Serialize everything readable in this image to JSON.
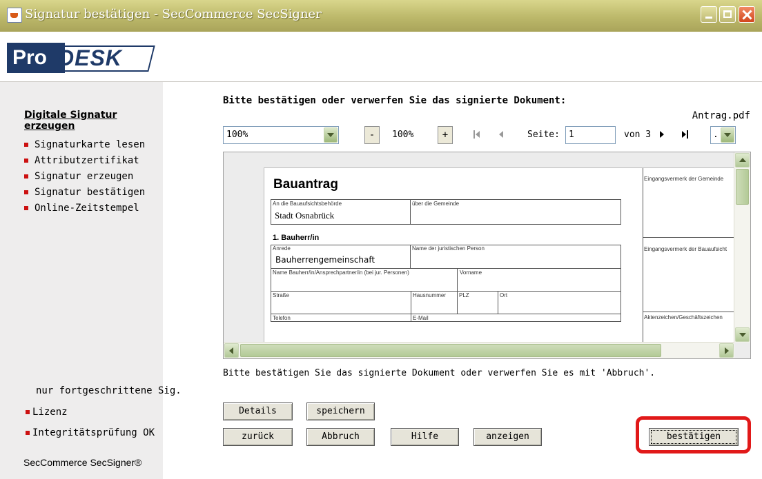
{
  "window": {
    "title": "Signatur bestätigen - SecCommerce SecSigner",
    "icon": "java-cup-icon"
  },
  "logo": {
    "part1": "Pro",
    "part2": "DESK"
  },
  "sidebar": {
    "heading": "Digitale Signatur erzeugen",
    "items": [
      {
        "label": "Signaturkarte lesen"
      },
      {
        "label": "Attributzertifikat"
      },
      {
        "label": "Signatur erzeugen"
      },
      {
        "label": "Signatur bestätigen"
      },
      {
        "label": "Online-Zeitstempel"
      }
    ],
    "note": "nur fortgeschrittene Sig.",
    "license": "Lizenz",
    "integrity": "Integritätsprüfung OK",
    "brand": "SecCommerce SecSigner®",
    "bullet_color": "#cc1111"
  },
  "main": {
    "prompt": "Bitte bestätigen oder verwerfen Sie das signierte Dokument:",
    "filename": "Antrag.pdf",
    "instruction": "Bitte bestätigen Sie das signierte Dokument oder verwerfen Sie es mit 'Abbruch'."
  },
  "toolbar": {
    "zoom_select": "100%",
    "zoom_out": "-",
    "zoom_value": "100%",
    "zoom_in": "+",
    "page_label": "Seite:",
    "page_value": "1",
    "of_label": "von 3",
    "mode_select": "."
  },
  "document": {
    "title": "Bauantrag",
    "field_authority": "An die Bauaufsichtsbehörde",
    "value_authority": "Stadt Osnabrück",
    "field_municipality": "über die Gemeinde",
    "stamp_municipality": "Eingangsvermerk der Gemeinde",
    "section1": "1. Bauherr/in",
    "field_salutation": "Anrede",
    "value_salutation": "Bauherrengemeinschaft",
    "field_legal": "Name der juristischen Person",
    "stamp_authority": "Eingangsvermerk der Bauaufsicht",
    "field_name": "Name Bauherr/in/Ansprechpartner/in (bei jur. Personen)",
    "field_firstname": "Vorname",
    "field_street": "Straße",
    "field_housenr": "Hausnummer",
    "field_zip": "PLZ",
    "field_city": "Ort",
    "field_phone": "Telefon",
    "field_email": "E-Mail",
    "field_fileref": "Aktenzeichen/Geschäftszeichen"
  },
  "buttons": {
    "details": "Details",
    "save": "speichern",
    "back": "zurück",
    "cancel": "Abbruch",
    "help": "Hilfe",
    "show": "anzeigen",
    "confirm": "bestätigen"
  },
  "colors": {
    "titlebar": "#bcb86a",
    "highlight": "#e11919",
    "logo_blue": "#1f3a68"
  }
}
